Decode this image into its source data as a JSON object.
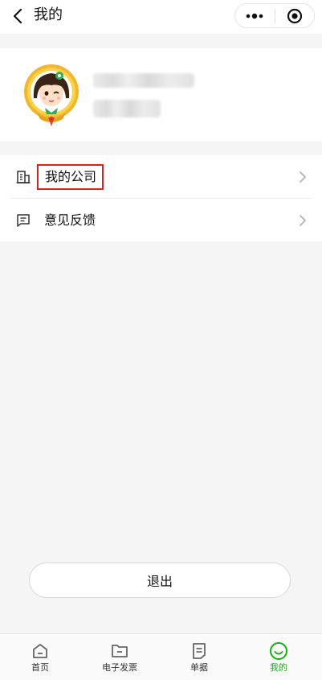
{
  "header": {
    "title": "我的",
    "back_icon": "chevron-left-icon",
    "more_icon": "more-dots-icon",
    "close_icon": "target-close-icon"
  },
  "profile": {
    "avatar_icon": "avatar-badge-icon"
  },
  "menu": {
    "items": [
      {
        "label": "我的公司",
        "icon": "building-icon",
        "highlighted": true
      },
      {
        "label": "意见反馈",
        "icon": "feedback-icon",
        "highlighted": false
      }
    ]
  },
  "logout": {
    "label": "退出"
  },
  "tabbar": {
    "active_color": "#1aad19",
    "tabs": [
      {
        "label": "首页",
        "icon": "home-icon",
        "active": false
      },
      {
        "label": "电子发票",
        "icon": "folder-icon",
        "active": false
      },
      {
        "label": "单据",
        "icon": "document-icon",
        "active": false
      },
      {
        "label": "我的",
        "icon": "smile-icon",
        "active": true
      }
    ]
  }
}
